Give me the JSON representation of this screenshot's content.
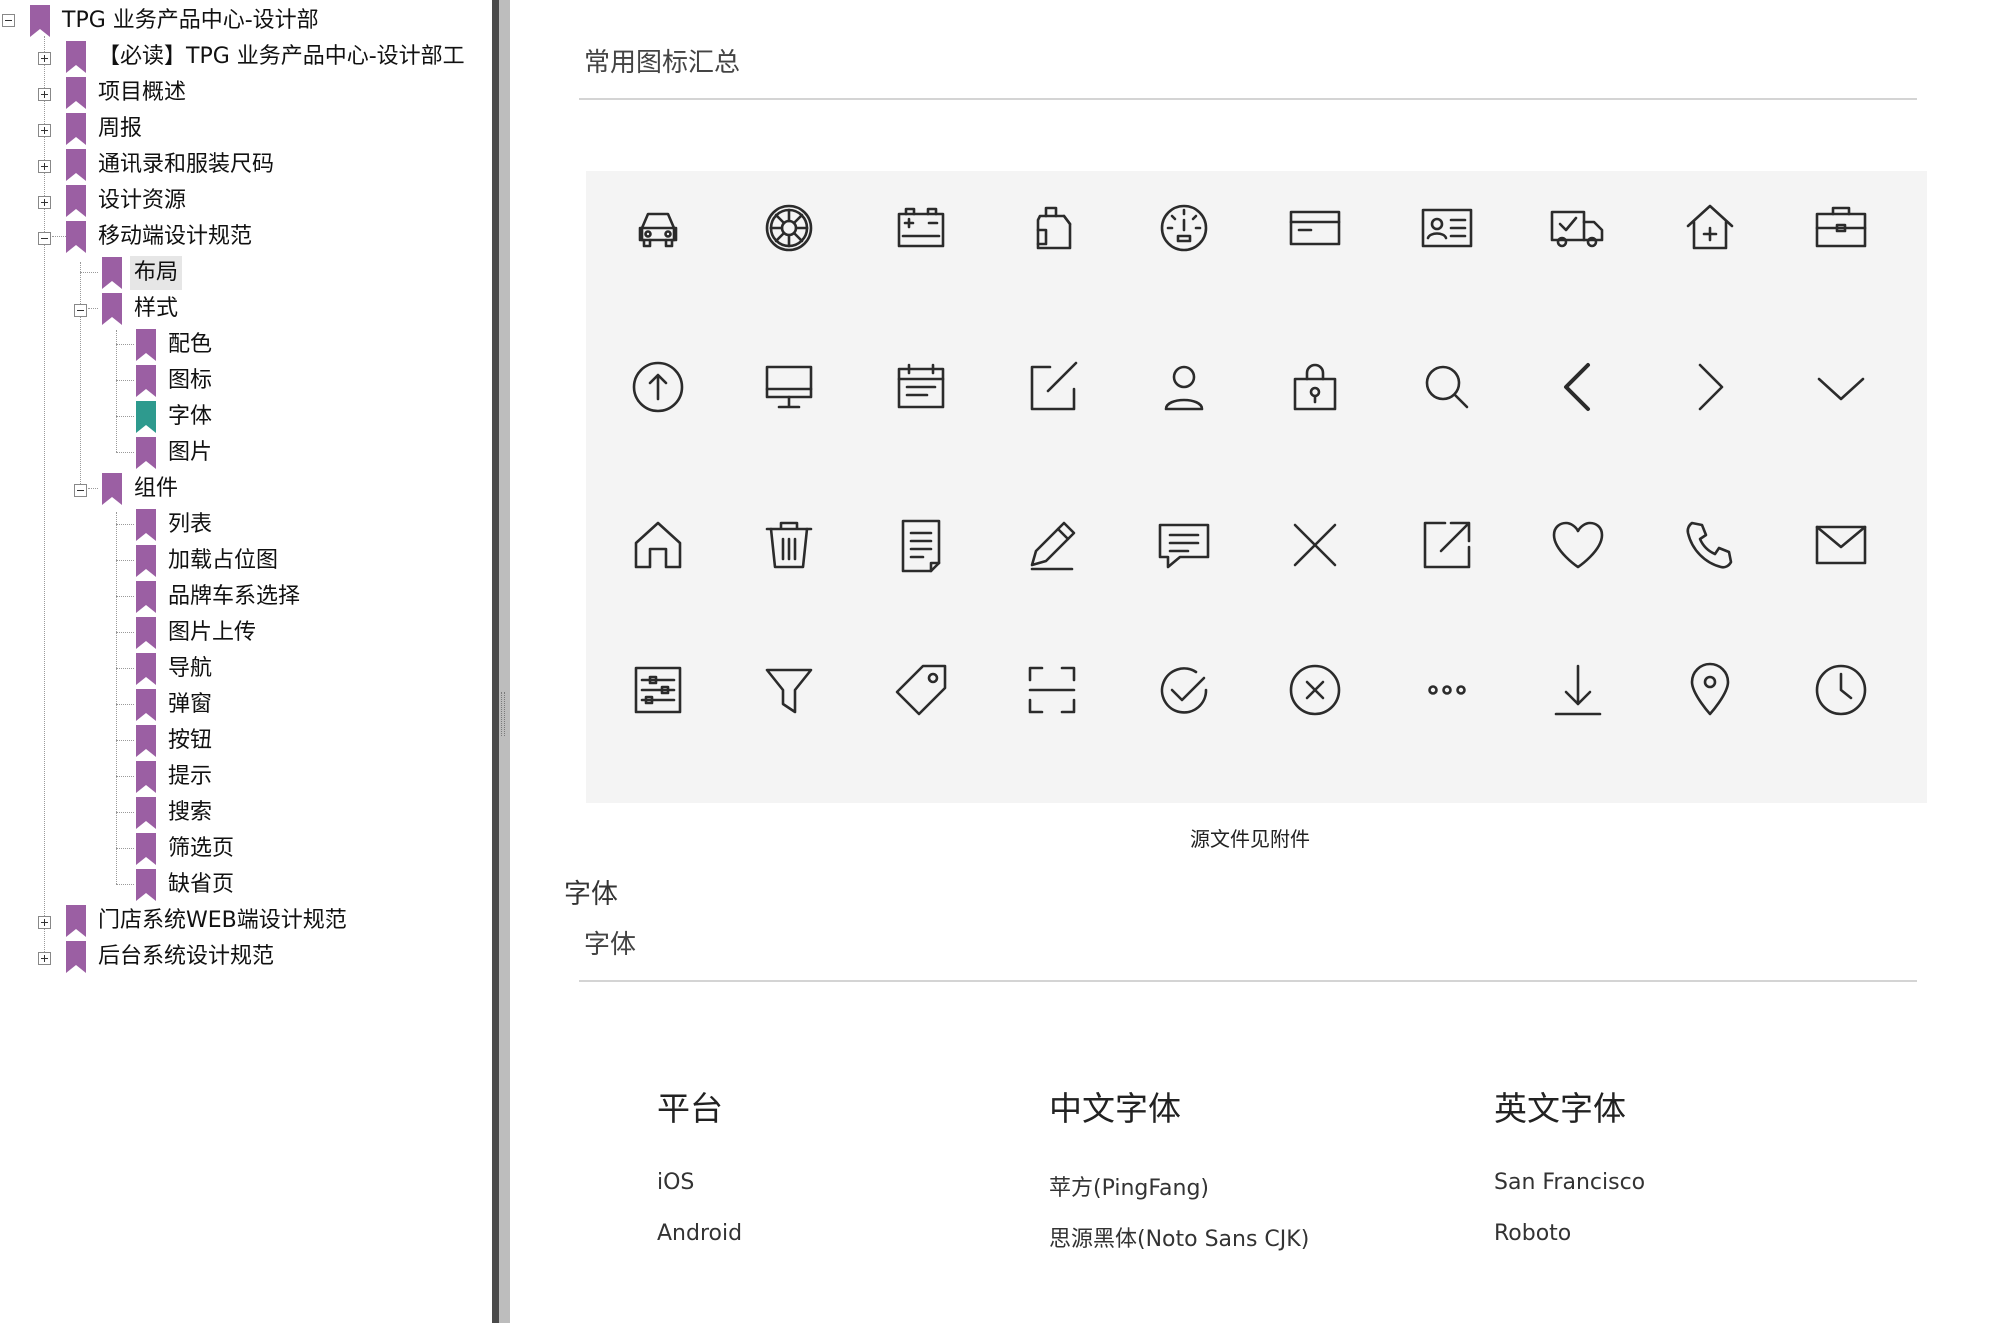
{
  "tree": {
    "root": "TPG 业务产品中心-设计部",
    "items": [
      "【必读】TPG 业务产品中心-设计部工",
      "项目概述",
      "周报",
      "通讯录和服装尺码",
      "设计资源",
      "移动端设计规范",
      "布局",
      "样式",
      "配色",
      "图标",
      "字体",
      "图片",
      "组件",
      "列表",
      "加载占位图",
      "品牌车系选择",
      "图片上传",
      "导航",
      "弹窗",
      "按钮",
      "提示",
      "搜索",
      "筛选页",
      "缺省页",
      "门店系统WEB端设计规范",
      "后台系统设计规范"
    ]
  },
  "colors": {
    "bookmark": "#9b5fa3",
    "bookmark_active": "#2e9a8e",
    "panel_bg": "#f4f4f4",
    "divider": "#bdbdbd"
  },
  "content": {
    "icons_title": "常用图标汇总",
    "icons": [
      [
        "car-icon",
        "tire-icon",
        "battery-icon",
        "oil-can-icon",
        "speedometer-icon",
        "card-icon",
        "id-card-icon",
        "truck-check-icon",
        "house-plus-icon",
        "briefcase-icon"
      ],
      [
        "arrow-up-circle-icon",
        "monitor-icon",
        "calendar-icon",
        "edit-square-icon",
        "user-icon",
        "lock-bag-icon",
        "search-icon",
        "chevron-left-icon",
        "chevron-right-icon",
        "chevron-down-icon"
      ],
      [
        "home-icon",
        "trash-icon",
        "document-icon",
        "pencil-icon",
        "chat-icon",
        "close-icon",
        "share-icon",
        "heart-icon",
        "phone-icon",
        "mail-icon"
      ],
      [
        "settings-sliders-icon",
        "filter-icon",
        "tag-icon",
        "scan-icon",
        "check-circle-icon",
        "close-circle-icon",
        "more-icon",
        "download-icon",
        "location-icon",
        "clock-icon"
      ]
    ],
    "caption": "源文件见附件",
    "font_section_heading": "字体",
    "font_title": "字体",
    "font_table": {
      "headers": [
        "平台",
        "中文字体",
        "英文字体"
      ],
      "rows": [
        [
          "iOS",
          "苹方(PingFang)",
          "San Francisco"
        ],
        [
          "Android",
          "思源黑体(Noto Sans CJK)",
          "Roboto"
        ]
      ]
    }
  }
}
